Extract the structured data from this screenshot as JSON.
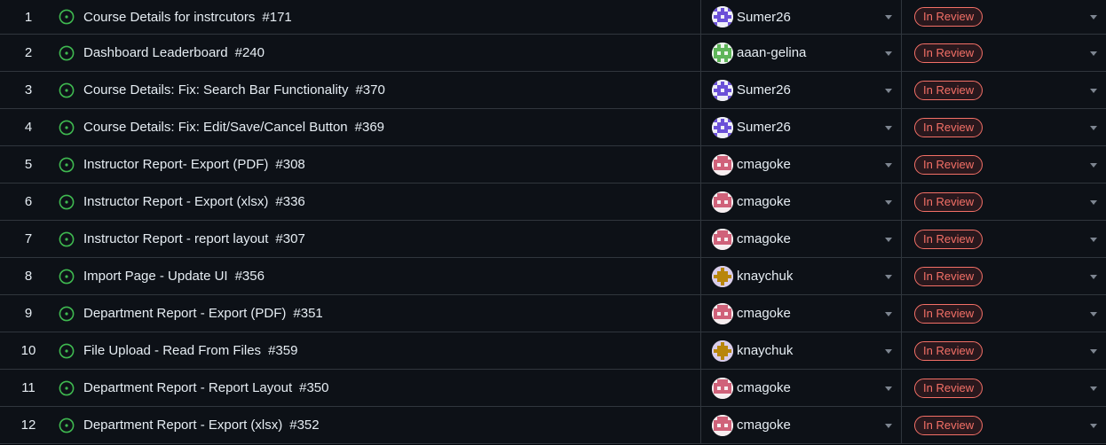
{
  "colors": {
    "background": "#0d1117",
    "border": "#30363d",
    "text": "#e6edf3",
    "open_icon": "#3fb950",
    "status_badge": "#f47067"
  },
  "rows": [
    {
      "num": "1",
      "title": "Course Details for instrcutors",
      "issue": "#171",
      "assignee": "Sumer26",
      "avatar": "purple",
      "status": "In Review"
    },
    {
      "num": "2",
      "title": "Dashboard Leaderboard",
      "issue": "#240",
      "assignee": "aaan-gelina",
      "avatar": "green",
      "status": "In Review"
    },
    {
      "num": "3",
      "title": "Course Details: Fix: Search Bar Functionality",
      "issue": "#370",
      "assignee": "Sumer26",
      "avatar": "purple",
      "status": "In Review"
    },
    {
      "num": "4",
      "title": "Course Details: Fix: Edit/Save/Cancel Button",
      "issue": "#369",
      "assignee": "Sumer26",
      "avatar": "purple",
      "status": "In Review"
    },
    {
      "num": "5",
      "title": "Instructor Report- Export (PDF)",
      "issue": "#308",
      "assignee": "cmagoke",
      "avatar": "pink",
      "status": "In Review"
    },
    {
      "num": "6",
      "title": "Instructor Report - Export (xlsx)",
      "issue": "#336",
      "assignee": "cmagoke",
      "avatar": "pink",
      "status": "In Review"
    },
    {
      "num": "7",
      "title": "Instructor Report - report layout",
      "issue": "#307",
      "assignee": "cmagoke",
      "avatar": "pink",
      "status": "In Review"
    },
    {
      "num": "8",
      "title": "Import Page - Update UI",
      "issue": "#356",
      "assignee": "knaychuk",
      "avatar": "lilac",
      "status": "In Review"
    },
    {
      "num": "9",
      "title": "Department Report - Export (PDF)",
      "issue": "#351",
      "assignee": "cmagoke",
      "avatar": "pink",
      "status": "In Review"
    },
    {
      "num": "10",
      "title": "File Upload - Read From Files",
      "issue": "#359",
      "assignee": "knaychuk",
      "avatar": "lilac",
      "status": "In Review"
    },
    {
      "num": "11",
      "title": "Department Report - Report Layout",
      "issue": "#350",
      "assignee": "cmagoke",
      "avatar": "pink",
      "status": "In Review"
    },
    {
      "num": "12",
      "title": "Department Report - Export (xlsx)",
      "issue": "#352",
      "assignee": "cmagoke",
      "avatar": "pink",
      "status": "In Review"
    }
  ]
}
